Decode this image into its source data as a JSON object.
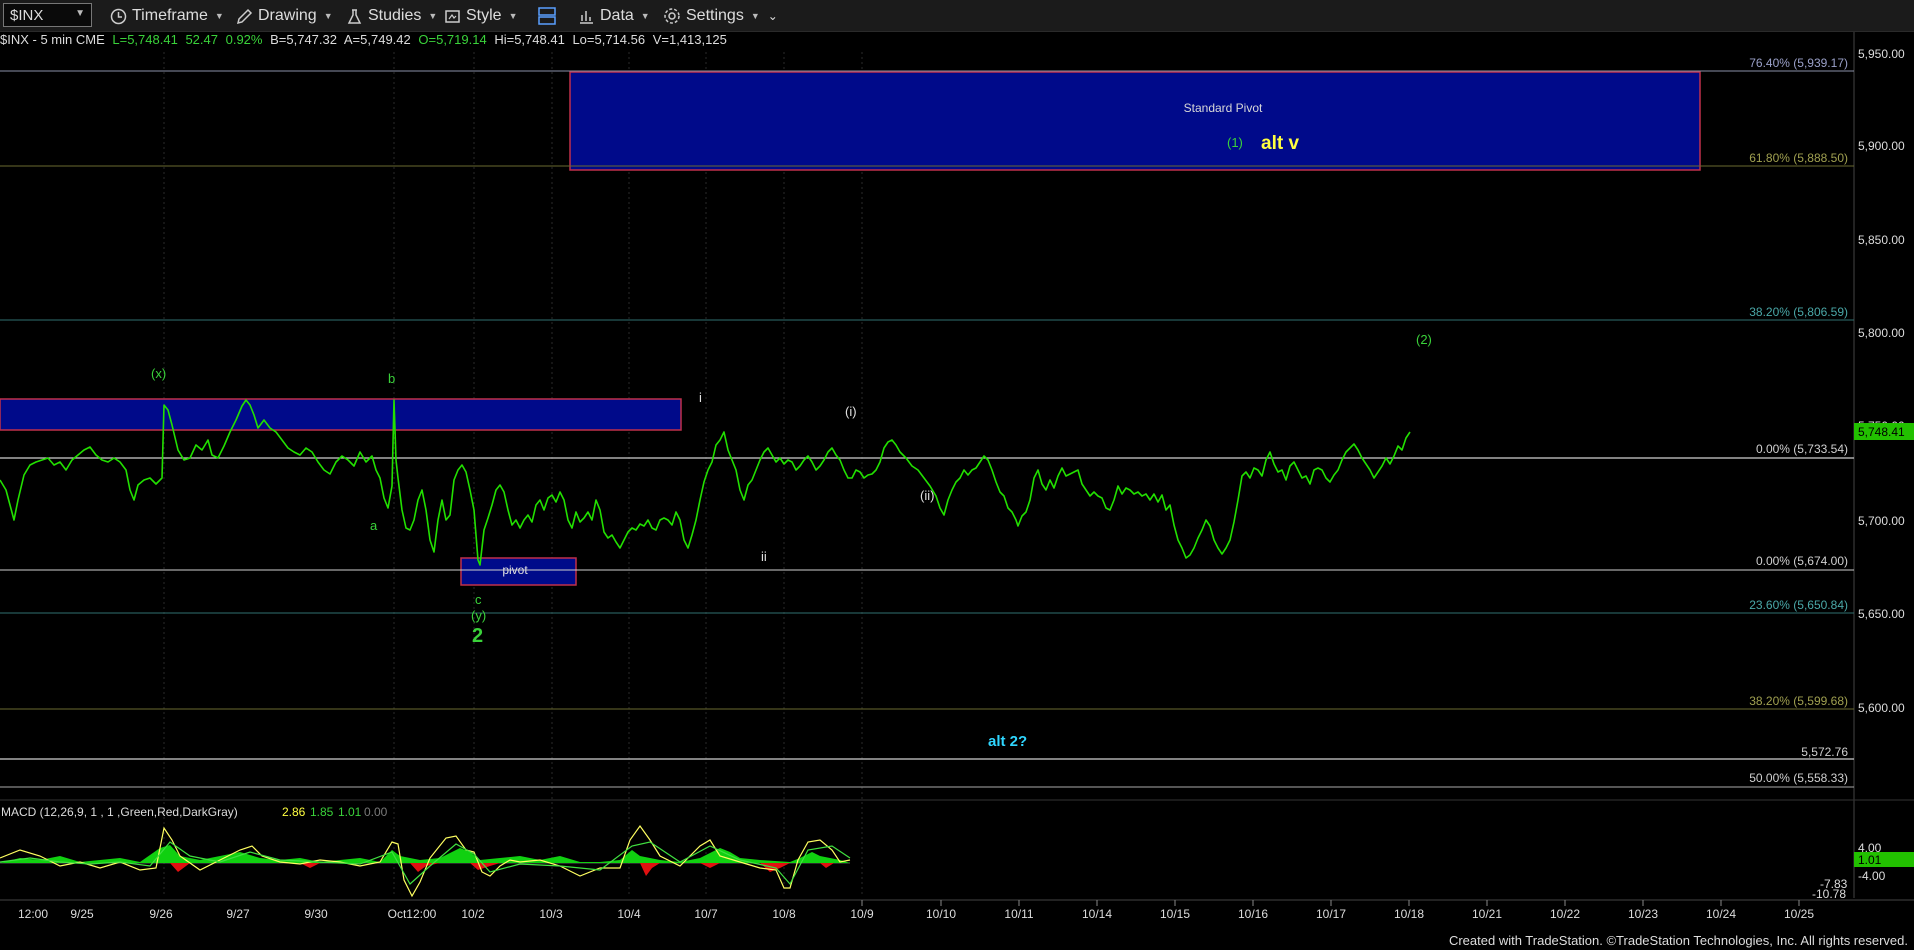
{
  "toolbar": {
    "symbol": "$INX",
    "timeframe": "Timeframe",
    "drawing": "Drawing",
    "studies": "Studies",
    "style": "Style",
    "data": "Data",
    "settings": "Settings"
  },
  "header": {
    "symbol_info": "$INX - 5 min  CME",
    "last": "L=5,748.41",
    "change": "52.47",
    "change_pct": "0.92%",
    "bid": "B=5,747.32",
    "ask": "A=5,749.42",
    "open": "O=5,719.14",
    "high": "Hi=5,748.41",
    "low": "Lo=5,714.56",
    "volume": "V=1,413,125"
  },
  "price_axis": {
    "ticks": [
      "5,950.00",
      "5,900.00",
      "5,850.00",
      "5,800.00",
      "5,750.00",
      "5,700.00",
      "5,650.00",
      "5,600.00"
    ],
    "current_price": "5,748.41"
  },
  "levels": [
    {
      "label": "76.40% (5,939.17)",
      "color": "#9aa0b8"
    },
    {
      "label": "61.80% (5,888.50)",
      "color": "#8a8a40"
    },
    {
      "label": "38.20% (5,806.59)",
      "color": "#4a9a9a"
    },
    {
      "label": "0.00% (5,733.54)",
      "color": "#cfcfcf"
    },
    {
      "label": "0.00% (5,674.00)",
      "color": "#cfcfcf"
    },
    {
      "label": "23.60% (5,650.84)",
      "color": "#4a9a9a"
    },
    {
      "label": "38.20% (5,599.68)",
      "color": "#8a8a40"
    },
    {
      "label": "5,572.76",
      "color": "#cfcfcf"
    },
    {
      "label": "50.00% (5,558.33)",
      "color": "#cfcfcf"
    }
  ],
  "boxes": {
    "standard_pivot": "Standard Pivot",
    "pivot": "pivot"
  },
  "wave_labels": {
    "x_paren": "(x)",
    "b": "b",
    "a": "a",
    "c": "c",
    "y_paren": "(y)",
    "two": "2",
    "i": "i",
    "ii": "ii",
    "i_paren": "(i)",
    "ii_paren": "(ii)",
    "one_paren": "(1)",
    "alt_v": "alt v",
    "two_paren": "(2)",
    "alt_2": "alt 2?"
  },
  "macd": {
    "label": "MACD (12,26,9, 1 , 1 ,Green,Red,DarkGray)",
    "v1": "2.86",
    "v2": "1.85",
    "v3": "1.01",
    "v4": "0.00",
    "axis_ticks": [
      "4.00",
      "1.01",
      "-4.00",
      "-7.83",
      "-10.78"
    ]
  },
  "x_axis": {
    "ticks": [
      "12:00",
      "9/25",
      "9/26",
      "9/27",
      "9/30",
      "Oct12:00",
      "10/2",
      "10/3",
      "10/4",
      "10/7",
      "10/8",
      "10/9",
      "10/10",
      "10/11",
      "10/14",
      "10/15",
      "10/16",
      "10/17",
      "10/18",
      "10/21",
      "10/22",
      "10/23",
      "10/24",
      "10/25"
    ]
  },
  "footer": "Created with TradeStation. ©TradeStation Technologies, Inc. All rights reserved.",
  "colors": {
    "price_line": "#22e000",
    "wave_green": "#3ad23a",
    "box_fill": "#000a8a",
    "box_border": "#c0304a",
    "axis_text": "#dcdcdc",
    "alt_yellow": "#ffff40",
    "alt_cyan": "#2fd6ff"
  }
}
